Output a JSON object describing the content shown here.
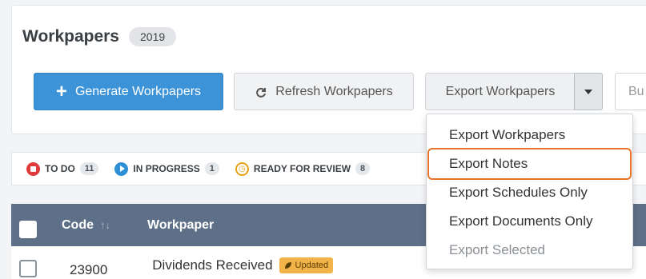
{
  "header": {
    "title": "Workpapers",
    "year_badge": "2019"
  },
  "toolbar": {
    "generate_label": "Generate Workpapers",
    "refresh_label": "Refresh Workpapers",
    "export_label": "Export Workpapers",
    "cut_label": "Bu"
  },
  "export_menu": {
    "items": [
      {
        "label": "Export Workpapers"
      },
      {
        "label": "Export Notes"
      },
      {
        "label": "Export Schedules Only"
      },
      {
        "label": "Export Documents Only"
      },
      {
        "label": "Export Selected"
      }
    ]
  },
  "filters": [
    {
      "label": "TO DO",
      "count": "11"
    },
    {
      "label": "IN PROGRESS",
      "count": "1"
    },
    {
      "label": "READY FOR REVIEW",
      "count": "8"
    }
  ],
  "table": {
    "headers": {
      "code": "Code",
      "workpaper": "Workpaper"
    },
    "rows": [
      {
        "code": "23900",
        "workpaper": "Dividends Received",
        "badge": "Updated"
      }
    ]
  },
  "colors": {
    "primary": "#3d93d7",
    "table_header": "#5d7088",
    "highlight_outline": "#e8732b",
    "todo": "#e03a3a",
    "in_progress": "#2d8fd6",
    "ready_for_review": "#e8a417",
    "updated_badge": "#f2b449"
  }
}
